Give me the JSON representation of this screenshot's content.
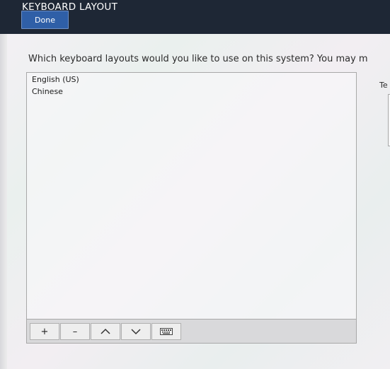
{
  "header": {
    "title": "KEYBOARD LAYOUT",
    "done_label": "Done"
  },
  "main": {
    "question": "Which keyboard layouts would you like to use on this system?  You may m",
    "layouts": [
      "English (US)",
      "Chinese"
    ],
    "toolbar": {
      "add": "+",
      "remove": "–",
      "up": "^",
      "down": "v",
      "keyboard_icon": "keyboard-icon"
    },
    "test_label": "Te"
  },
  "colors": {
    "header_bg": "#1e2735",
    "done_bg": "#2f5fa7",
    "content_bg": "#ececec"
  }
}
